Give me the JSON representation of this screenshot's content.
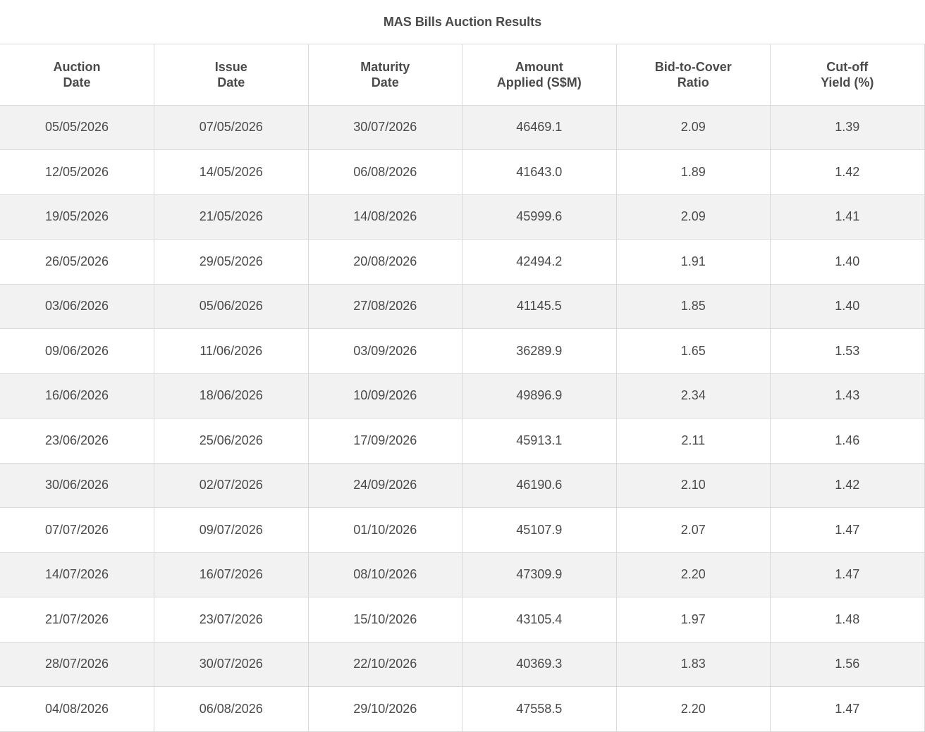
{
  "title": "MAS Bills Auction Results",
  "columns": [
    {
      "line1": "Auction",
      "line2": "Date"
    },
    {
      "line1": "Issue",
      "line2": "Date"
    },
    {
      "line1": "Maturity",
      "line2": "Date"
    },
    {
      "line1": "Amount",
      "line2": "Applied (S$M)"
    },
    {
      "line1": "Bid-to-Cover",
      "line2": "Ratio"
    },
    {
      "line1": "Cut-off",
      "line2": "Yield (%)"
    }
  ],
  "rows": [
    [
      "05/05/2026",
      "07/05/2026",
      "30/07/2026",
      "46469.1",
      "2.09",
      "1.39"
    ],
    [
      "12/05/2026",
      "14/05/2026",
      "06/08/2026",
      "41643.0",
      "1.89",
      "1.42"
    ],
    [
      "19/05/2026",
      "21/05/2026",
      "14/08/2026",
      "45999.6",
      "2.09",
      "1.41"
    ],
    [
      "26/05/2026",
      "29/05/2026",
      "20/08/2026",
      "42494.2",
      "1.91",
      "1.40"
    ],
    [
      "03/06/2026",
      "05/06/2026",
      "27/08/2026",
      "41145.5",
      "1.85",
      "1.40"
    ],
    [
      "09/06/2026",
      "11/06/2026",
      "03/09/2026",
      "36289.9",
      "1.65",
      "1.53"
    ],
    [
      "16/06/2026",
      "18/06/2026",
      "10/09/2026",
      "49896.9",
      "2.34",
      "1.43"
    ],
    [
      "23/06/2026",
      "25/06/2026",
      "17/09/2026",
      "45913.1",
      "2.11",
      "1.46"
    ],
    [
      "30/06/2026",
      "02/07/2026",
      "24/09/2026",
      "46190.6",
      "2.10",
      "1.42"
    ],
    [
      "07/07/2026",
      "09/07/2026",
      "01/10/2026",
      "45107.9",
      "2.07",
      "1.47"
    ],
    [
      "14/07/2026",
      "16/07/2026",
      "08/10/2026",
      "47309.9",
      "2.20",
      "1.47"
    ],
    [
      "21/07/2026",
      "23/07/2026",
      "15/10/2026",
      "43105.4",
      "1.97",
      "1.48"
    ],
    [
      "28/07/2026",
      "30/07/2026",
      "22/10/2026",
      "40369.3",
      "1.83",
      "1.56"
    ],
    [
      "04/08/2026",
      "06/08/2026",
      "29/10/2026",
      "47558.5",
      "2.20",
      "1.47"
    ]
  ]
}
